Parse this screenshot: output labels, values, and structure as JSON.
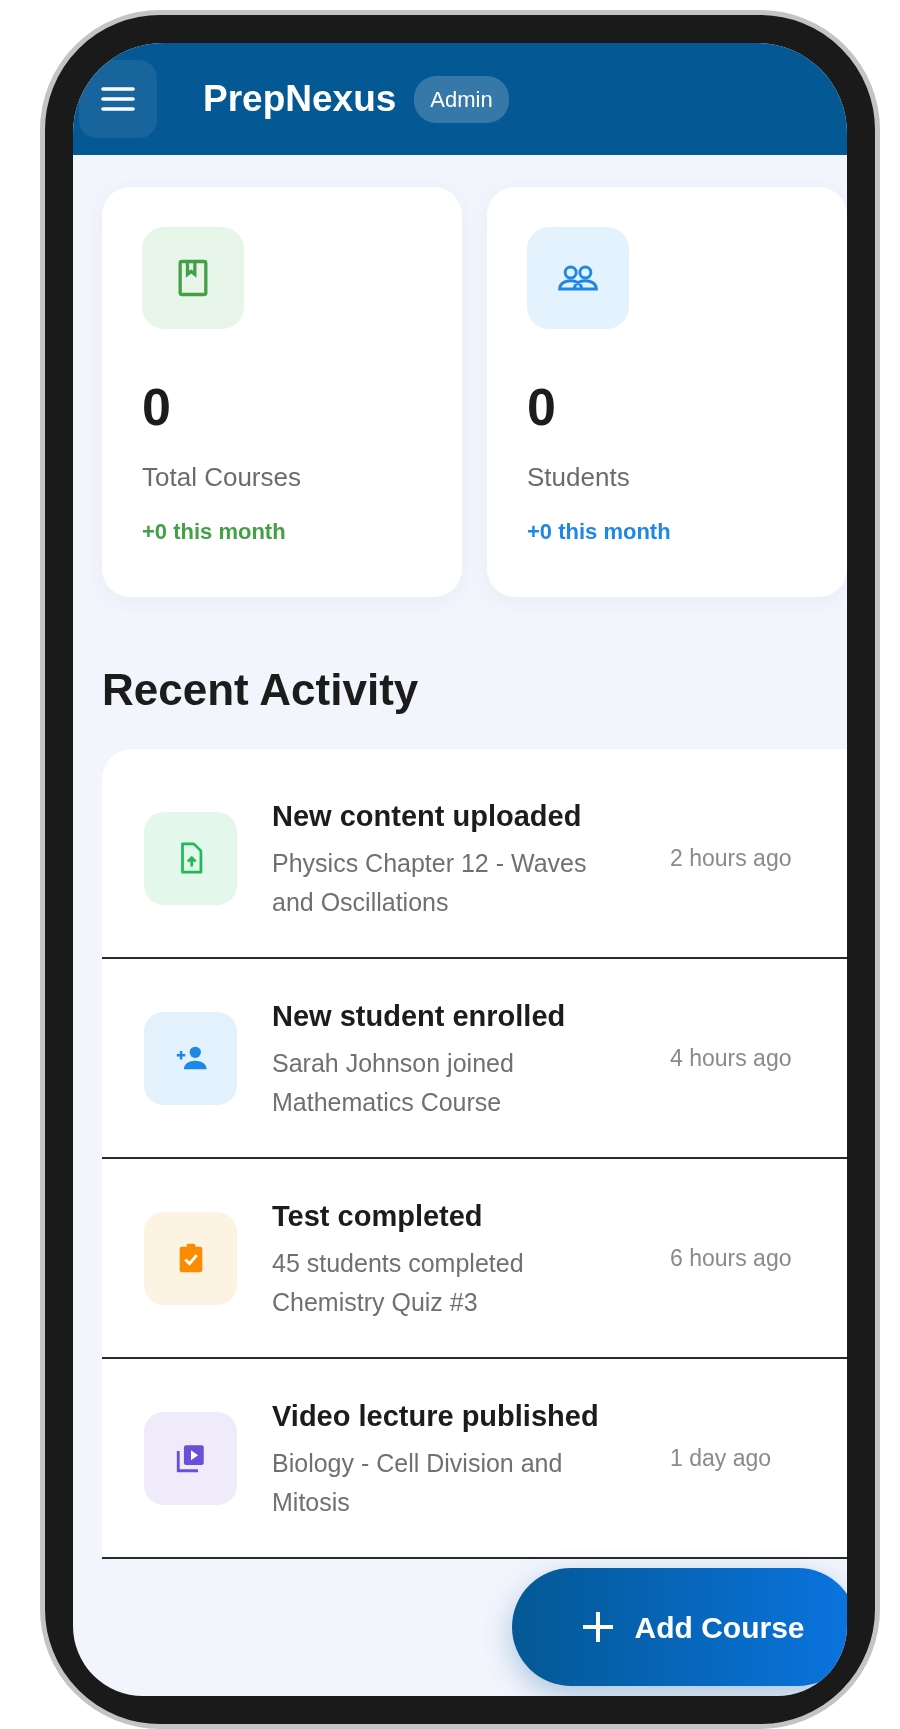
{
  "app_bar": {
    "title": "PrepNexus",
    "badge": "Admin"
  },
  "stats": [
    {
      "kind": "courses",
      "value": "0",
      "label": "Total Courses",
      "change": "+0 this month",
      "color": "#43a047"
    },
    {
      "kind": "students",
      "value": "0",
      "label": "Students",
      "change": "+0 this month",
      "color": "#1e88e5"
    }
  ],
  "recent_activity": {
    "title": "Recent Activity",
    "items": [
      {
        "kind": "upload",
        "title": "New content uploaded",
        "detail": "Physics Chapter 12 - Waves and Oscillations",
        "time": "2 hours ago"
      },
      {
        "kind": "enroll",
        "title": "New student enrolled",
        "detail": "Sarah Johnson joined Mathematics Course",
        "time": "4 hours ago"
      },
      {
        "kind": "test",
        "title": "Test completed",
        "detail": "45 students completed Chemistry Quiz #3",
        "time": "6 hours ago"
      },
      {
        "kind": "video",
        "title": "Video lecture published",
        "detail": "Biology - Cell Division and Mitosis",
        "time": "1 day ago"
      }
    ]
  },
  "fab": {
    "label": "Add Course"
  }
}
